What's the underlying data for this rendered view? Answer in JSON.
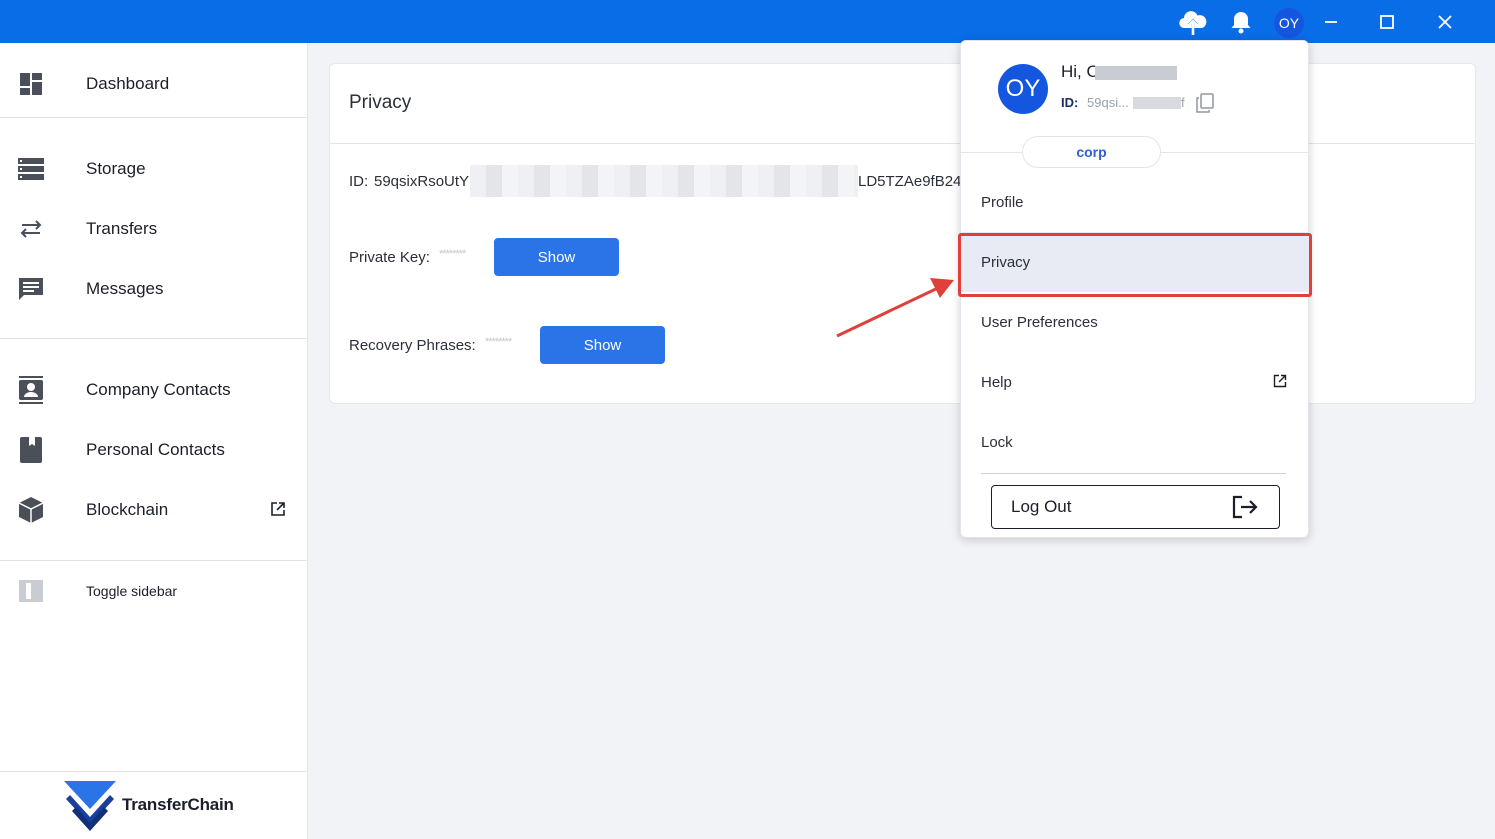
{
  "titlebar": {
    "avatar_initials": "OY",
    "accent_color": "#0a6de8",
    "icons": [
      "cloud-upload-icon",
      "bell-icon",
      "minimize-icon",
      "maximize-icon",
      "close-icon"
    ]
  },
  "sidebar": {
    "items": [
      {
        "label": "Dashboard",
        "icon": "dashboard-icon"
      },
      {
        "label": "Storage",
        "icon": "storage-icon"
      },
      {
        "label": "Transfers",
        "icon": "transfers-icon"
      },
      {
        "label": "Messages",
        "icon": "messages-icon"
      },
      {
        "label": "Company Contacts",
        "icon": "company-contacts-icon"
      },
      {
        "label": "Personal Contacts",
        "icon": "personal-contacts-icon"
      },
      {
        "label": "Blockchain",
        "icon": "blockchain-icon"
      }
    ],
    "toggle_label": "Toggle sidebar",
    "logo_text": "TransferChain"
  },
  "privacy": {
    "title": "Privacy",
    "id_label": "ID:",
    "id_prefix": "59qsixRsoUtY",
    "id_suffix": "LD5TZAe9fB24",
    "private_key_label": "Private Key:",
    "private_key_mask": "********",
    "recovery_label": "Recovery Phrases:",
    "recovery_mask": "********",
    "show_label": "Show"
  },
  "dropdown": {
    "avatar_initials": "OY",
    "greeting": "Hi, O",
    "id_label": "ID:",
    "id_value": "59qsi...",
    "id_tail": "f",
    "org_label": "corp",
    "items": [
      "Profile",
      "Privacy",
      "User Preferences",
      "Help",
      "Lock"
    ],
    "active_item": "Privacy",
    "logout_label": "Log Out"
  },
  "annotation": {
    "highlight_color": "#e0403a"
  }
}
